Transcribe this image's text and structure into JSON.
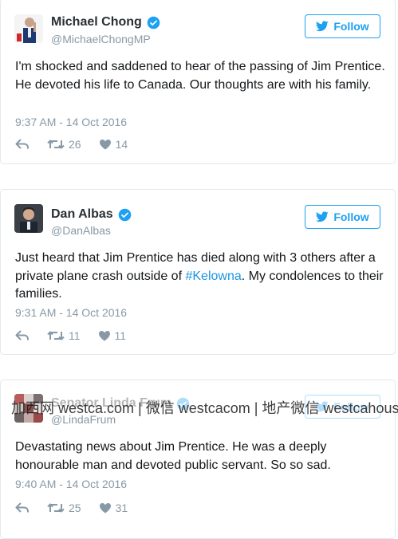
{
  "tweets": [
    {
      "name": "Michael Chong",
      "handle": "@MichaelChongMP",
      "follow": "Follow",
      "text": "I'm shocked and saddened to hear of the passing of Jim Prentice. He devoted his life to Canada. Our thoughts are with his family.",
      "time": "9:37 AM - 14 Oct 2016",
      "retweets": "26",
      "likes": "14"
    },
    {
      "name": "Dan Albas",
      "handle": "@DanAlbas",
      "follow": "Follow",
      "text_before": "Just heard that Jim Prentice has died along with 3 others after a private plane crash outside of ",
      "hashtag": "#Kelowna",
      "text_after": ". My condolences to their families.",
      "time": "9:31 AM - 14 Oct 2016",
      "retweets": "11",
      "likes": "11"
    },
    {
      "name": "Senator Linda Frum",
      "handle": "@LindaFrum",
      "follow": "Follow",
      "text": "Devastating news about Jim Prentice. He was a deeply honourable man and devoted public servant. So so sad.",
      "time": "9:40 AM - 14 Oct 2016",
      "retweets": "25",
      "likes": "31"
    }
  ],
  "watermark": "加西网 westca.com | 微信 westcacom | 地产微信 westcahouse",
  "colors": {
    "accent": "#1da1f2",
    "link": "#1b95e0",
    "muted": "#8899a6"
  }
}
